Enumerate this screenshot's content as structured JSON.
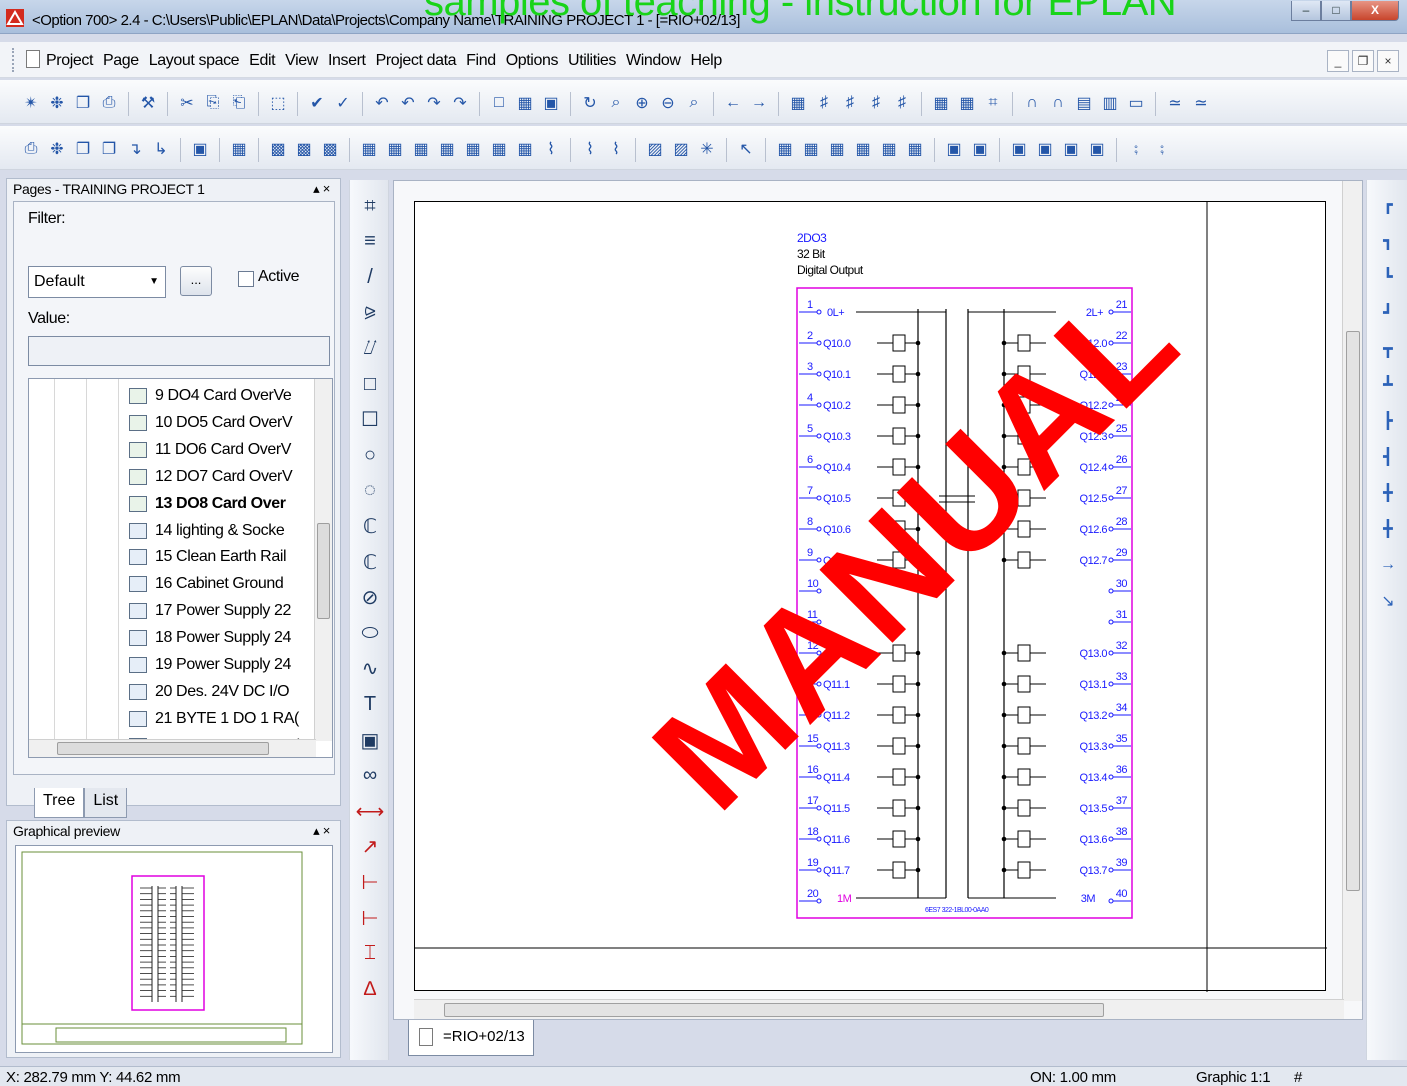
{
  "titlebar": {
    "title": "<Option 700> 2.4 - C:\\Users\\Public\\EPLAN\\Data\\Projects\\Company Name\\TRAINING PROJECT 1 - [=RIO+02/13]",
    "overlay": "samples of teaching - instruction for EPLAN",
    "min": "–",
    "max": "□",
    "close": "X"
  },
  "menubar": {
    "items": [
      "Project",
      "Page",
      "Layout space",
      "Edit",
      "View",
      "Insert",
      "Project data",
      "Find",
      "Options",
      "Utilities",
      "Window",
      "Help"
    ],
    "mdi_min": "_",
    "mdi_restore": "❐",
    "mdi_close": "×"
  },
  "pages_panel": {
    "title": "Pages - TRAINING PROJECT 1",
    "pin": "▴ ×",
    "filter_label": "Filter:",
    "filter_value": "Default",
    "more_button": "...",
    "active_label": "Active",
    "value_label": "Value:",
    "tree_items": [
      {
        "label": "9 DO4 Card OverVe",
        "bold": false
      },
      {
        "label": "10 DO5 Card OverV",
        "bold": false
      },
      {
        "label": "11 DO6 Card OverV",
        "bold": false
      },
      {
        "label": "12 DO7 Card OverV",
        "bold": false
      },
      {
        "label": "13 DO8 Card Over",
        "bold": true
      },
      {
        "label": "14 lighting & Socke",
        "bold": false
      },
      {
        "label": "15 Clean Earth Rail",
        "bold": false
      },
      {
        "label": "16 Cabinet Ground",
        "bold": false
      },
      {
        "label": "17 Power Supply 22",
        "bold": false
      },
      {
        "label": "18 Power Supply 24",
        "bold": false
      },
      {
        "label": "19 Power Supply 24",
        "bold": false
      },
      {
        "label": "20 Des. 24V DC I/O",
        "bold": false
      },
      {
        "label": "21 BYTE 1 DO 1 RA(",
        "bold": false
      },
      {
        "label": "22 BYTE 2 DO 1 RA(",
        "bold": false
      }
    ],
    "tabs": [
      "Tree",
      "List"
    ]
  },
  "preview_panel": {
    "title": "Graphical preview",
    "pin": "▴ ×"
  },
  "drawing": {
    "card_title": [
      "2DO3",
      "32 Bit",
      "Digital Output"
    ],
    "top_left": "0L+",
    "top_right": "2L+",
    "bottom_left": "1M",
    "bottom_right": "3M",
    "part_number": "6ES7 322-1BL00-0AA0",
    "left_pins": [
      {
        "n": "1",
        "s": ""
      },
      {
        "n": "2",
        "s": "Q10.0"
      },
      {
        "n": "3",
        "s": "Q10.1"
      },
      {
        "n": "4",
        "s": "Q10.2"
      },
      {
        "n": "5",
        "s": "Q10.3"
      },
      {
        "n": "6",
        "s": "Q10.4"
      },
      {
        "n": "7",
        "s": "Q10.5"
      },
      {
        "n": "8",
        "s": "Q10.6"
      },
      {
        "n": "9",
        "s": "Q10.7"
      },
      {
        "n": "10",
        "s": ""
      },
      {
        "n": "11",
        "s": ""
      },
      {
        "n": "12",
        "s": "Q11.0"
      },
      {
        "n": "13",
        "s": "Q11.1"
      },
      {
        "n": "14",
        "s": "Q11.2"
      },
      {
        "n": "15",
        "s": "Q11.3"
      },
      {
        "n": "16",
        "s": "Q11.4"
      },
      {
        "n": "17",
        "s": "Q11.5"
      },
      {
        "n": "18",
        "s": "Q11.6"
      },
      {
        "n": "19",
        "s": "Q11.7"
      },
      {
        "n": "20",
        "s": ""
      }
    ],
    "right_pins": [
      {
        "n": "21",
        "s": ""
      },
      {
        "n": "22",
        "s": "Q12.0"
      },
      {
        "n": "23",
        "s": "Q12.1"
      },
      {
        "n": "24",
        "s": "Q12.2"
      },
      {
        "n": "25",
        "s": "Q12.3"
      },
      {
        "n": "26",
        "s": "Q12.4"
      },
      {
        "n": "27",
        "s": "Q12.5"
      },
      {
        "n": "28",
        "s": "Q12.6"
      },
      {
        "n": "29",
        "s": "Q12.7"
      },
      {
        "n": "30",
        "s": ""
      },
      {
        "n": "31",
        "s": ""
      },
      {
        "n": "32",
        "s": "Q13.0"
      },
      {
        "n": "33",
        "s": "Q13.1"
      },
      {
        "n": "34",
        "s": "Q13.2"
      },
      {
        "n": "35",
        "s": "Q13.3"
      },
      {
        "n": "36",
        "s": "Q13.4"
      },
      {
        "n": "37",
        "s": "Q13.5"
      },
      {
        "n": "38",
        "s": "Q13.6"
      },
      {
        "n": "39",
        "s": "Q13.7"
      },
      {
        "n": "40",
        "s": ""
      }
    ],
    "sheet_tab": "=RIO+02/13"
  },
  "statusbar": {
    "coords": "X: 282.79 mm   Y: 44.62 mm",
    "on": "ON: 1.00 mm",
    "graphic": "Graphic 1:1",
    "hash": "#"
  },
  "watermark": "MANUAL",
  "colors": {
    "module": "#e000e0",
    "label_blue": "#1a1aff",
    "watermark": "#ff0000",
    "overlay_green": "#19d419"
  }
}
